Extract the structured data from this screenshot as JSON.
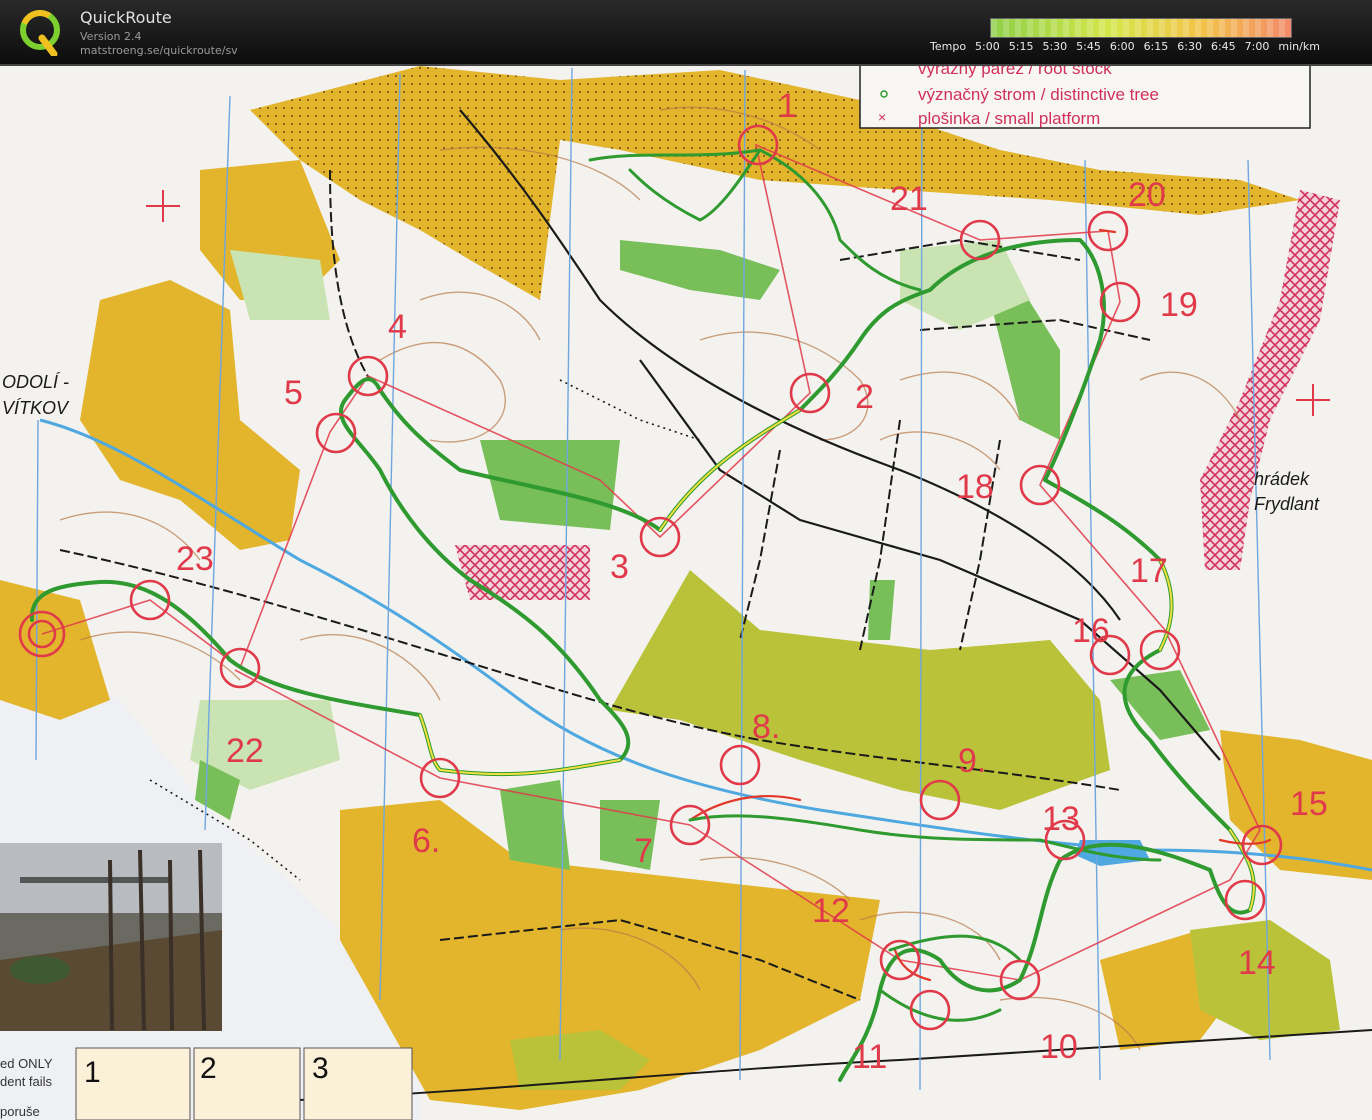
{
  "app": {
    "title": "QuickRoute",
    "version": "Version 2.4",
    "url": "matstroeng.se/quickroute/sv"
  },
  "tempo_legend": {
    "label": "Tempo",
    "ticks": [
      "5:00",
      "5:15",
      "5:30",
      "5:45",
      "6:00",
      "6:15",
      "6:30",
      "6:45",
      "7:00"
    ],
    "unit": "min/km",
    "colors": [
      "#8ed04a",
      "#d6e64a",
      "#f2c44a",
      "#f28a6a"
    ]
  },
  "map": {
    "legend_lines": [
      "výrazný pařez / root stock",
      "význačný strom / distinctive tree",
      "plošinka / small platform"
    ],
    "place_labels": [
      "hrádek",
      "Frydlant",
      "ODOLÍ -",
      "VÍTKOV"
    ],
    "control_numbers": [
      "1",
      "2",
      "3",
      "4",
      "5",
      "6.",
      "7",
      "8.",
      "9.",
      "10",
      "11",
      "12",
      "13",
      "14",
      "15",
      "16",
      "17",
      "18",
      "19",
      "20",
      "21",
      "22",
      "23"
    ],
    "bottom_legend": {
      "left_text": [
        "ed ONLY",
        "dent fails",
        "poruše"
      ],
      "boxes": [
        "1",
        "2",
        "3"
      ]
    },
    "colors": {
      "paper": "#f4f2ee",
      "open": "#e2b52c",
      "olive": "#b9c238",
      "green": "#78bf5a",
      "light_green": "#c9e3b2",
      "course": "#e03a4a",
      "route_green": "#2f9a2f",
      "route_red": "#e23a2a",
      "route_yellow": "#f0e040",
      "magnetic": "#6fa6e0",
      "contour": "#b77a4a"
    }
  }
}
